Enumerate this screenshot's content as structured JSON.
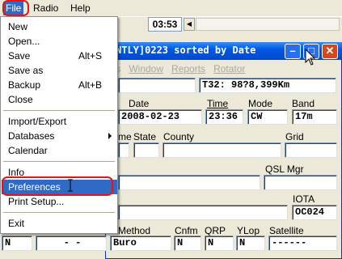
{
  "menubar": {
    "file": "File",
    "radio": "Radio",
    "help": "Help"
  },
  "toolbar": {
    "clock": "03:53"
  },
  "window": {
    "title": "NTLY]0223 sorted by Date",
    "submenu": [
      "els",
      "Window",
      "Reports",
      "Rotator"
    ],
    "controls": {
      "minimize": "–",
      "maximize": "□",
      "close": "✕"
    }
  },
  "log": {
    "call_info": "T32: 98?8,399Km",
    "labels": {
      "date": "Date",
      "time": "Time",
      "mode": "Mode",
      "band": "Band",
      "name_fragment": "me",
      "state": "State",
      "county": "County",
      "grid": "Grid",
      "qsl_mgr": "QSL Mgr",
      "iota": "IOTA",
      "method": "Method",
      "cnfm": "Cnfm",
      "qrp": "QRP",
      "ylop": "YLop",
      "satellite": "Satellite"
    },
    "values": {
      "date": "2008-02-23",
      "time": "23:36",
      "mode": "CW",
      "band": "17m",
      "iota": "OC024",
      "left_n": "N",
      "dashes": "-   -",
      "method": "Buro",
      "cnfm": "N",
      "qrp": "N",
      "ylop": "N",
      "satellite": "------"
    }
  },
  "file_menu": {
    "items": [
      {
        "label": "New",
        "shortcut": ""
      },
      {
        "label": "Open...",
        "shortcut": ""
      },
      {
        "label": "Save",
        "shortcut": "Alt+S"
      },
      {
        "label": "Save as",
        "shortcut": ""
      },
      {
        "label": "Backup",
        "shortcut": "Alt+B"
      },
      {
        "label": "Close",
        "shortcut": ""
      },
      {
        "label": "Import/Export",
        "shortcut": ""
      },
      {
        "label": "Databases",
        "shortcut": ""
      },
      {
        "label": "Calendar",
        "shortcut": ""
      },
      {
        "label": "Info",
        "shortcut": ""
      },
      {
        "label": "Preferences",
        "shortcut": ""
      },
      {
        "label": "Print Setup...",
        "shortcut": ""
      },
      {
        "label": "Exit",
        "shortcut": ""
      }
    ]
  }
}
